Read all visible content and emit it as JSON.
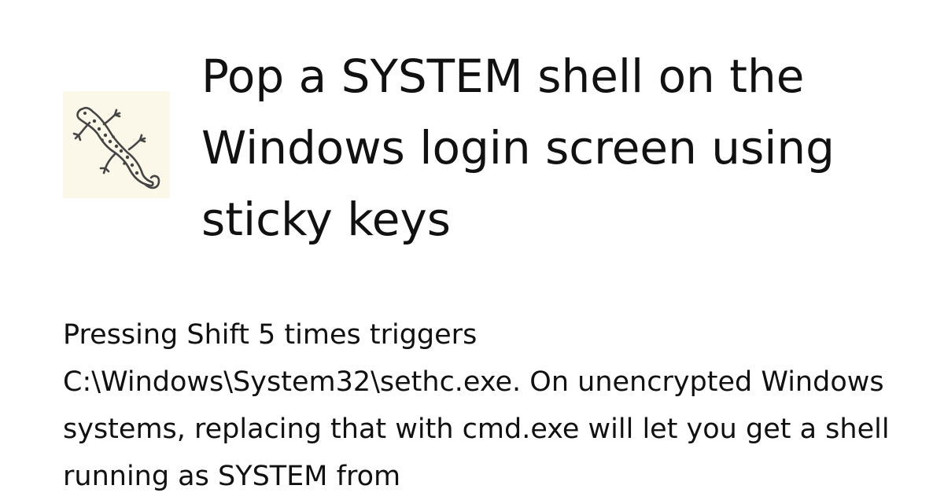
{
  "card": {
    "logo": {
      "icon": "gecko-icon",
      "background": "#fbf8e9",
      "stroke": "#444444"
    },
    "title": "Pop a SYSTEM shell on the Windows login screen using sticky keys",
    "description": "Pressing Shift 5 times triggers C:\\Windows\\System32\\sethc.exe. On unencrypted Windows systems, replacing that with cmd.exe will let you get a shell running as SYSTEM from"
  }
}
